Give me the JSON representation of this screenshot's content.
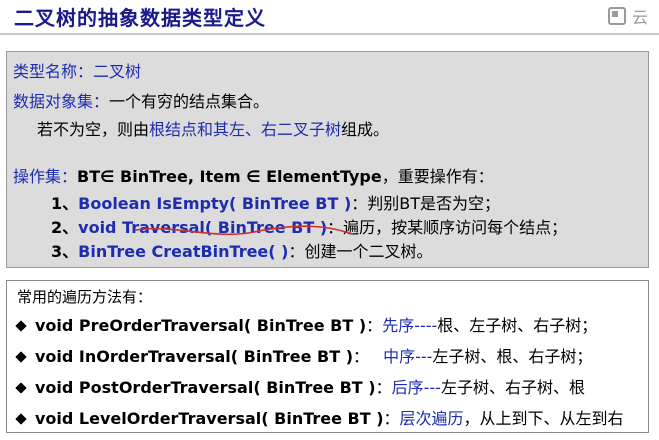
{
  "title": "二叉树的抽象数据类型定义",
  "watermark": "云",
  "definition": {
    "type_name_label": "类型名称：",
    "type_name_value": "二叉树",
    "data_objects_label": "数据对象集：",
    "data_objects_value": "一个有穷的结点集合。",
    "nonempty_prefix": "若不为空，则由",
    "nonempty_highlight": "根结点和其左、右二叉子树",
    "nonempty_suffix": "组成。",
    "ops_label": "操作集：",
    "ops_text": "BT∈ BinTree, Item ∈ ElementType",
    "ops_suffix": "，重要操作有：",
    "operations": [
      {
        "num": "1、",
        "sig": "Boolean IsEmpty( BinTree BT )",
        "desc": "：判别BT是否为空；"
      },
      {
        "num": "2、",
        "sig": "void Traversal( BinTree BT )",
        "desc": "：遍历，按某顺序访问每个结点；"
      },
      {
        "num": "3、",
        "sig": "BinTree CreatBinTree( )",
        "desc": "：创建一个二叉树。"
      }
    ]
  },
  "traversal": {
    "heading": "常用的遍历方法有：",
    "items": [
      {
        "sig": "void PreOrderTraversal( BinTree BT )",
        "colon": "：",
        "name": "先序----",
        "desc": "根、左子树、右子树；"
      },
      {
        "sig": "void InOrderTraversal( BinTree BT )",
        "colon": "：",
        "name": "中序---",
        "desc": "左子树、根、右子树；"
      },
      {
        "sig": "void PostOrderTraversal( BinTree BT )",
        "colon": "：",
        "name": "后序---",
        "desc": "左子树、右子树、根"
      },
      {
        "sig": "void LevelOrderTraversal( BinTree BT )",
        "colon": "：",
        "name": "层次遍历",
        "desc": "，从上到下、从左到右"
      }
    ]
  },
  "colors": {
    "title": "#1a1a8c",
    "keyword": "#1d2db0",
    "box_bg": "#dcdcdc",
    "underline": "#d03030"
  }
}
